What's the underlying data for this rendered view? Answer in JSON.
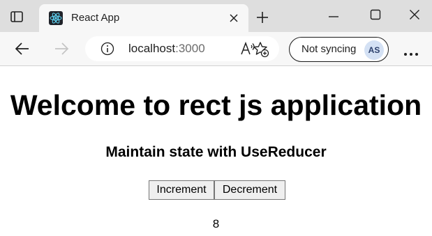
{
  "browser": {
    "tab": {
      "title": "React App",
      "favicon": "react-logo-icon"
    },
    "address_bar": {
      "host": "localhost",
      "port": ":3000"
    },
    "profile": {
      "sync_label": "Not syncing",
      "avatar_initials": "AS"
    },
    "icons": {
      "tab_actions": "tab-actions-icon",
      "close_tab": "close-icon",
      "new_tab": "plus-icon",
      "minimize": "minimize-icon",
      "maximize": "maximize-icon",
      "close_window": "close-icon",
      "back": "back-arrow-icon",
      "forward": "forward-arrow-icon",
      "site_info": "info-icon",
      "read_aloud": "read-aloud-icon",
      "add_favorite": "favorite-add-icon",
      "more": "more-icon"
    },
    "colors": {
      "tabstrip_bg": "#dedede",
      "toolbar_bg": "#f7f7f7",
      "react_cyan": "#61dafb",
      "avatar_bg": "#d4e1f4"
    }
  },
  "page": {
    "heading": "Welcome to rect js application",
    "subheading": "Maintain state with UseReducer",
    "buttons": {
      "increment": "Increment",
      "decrement": "Decrement"
    },
    "count": "8"
  }
}
